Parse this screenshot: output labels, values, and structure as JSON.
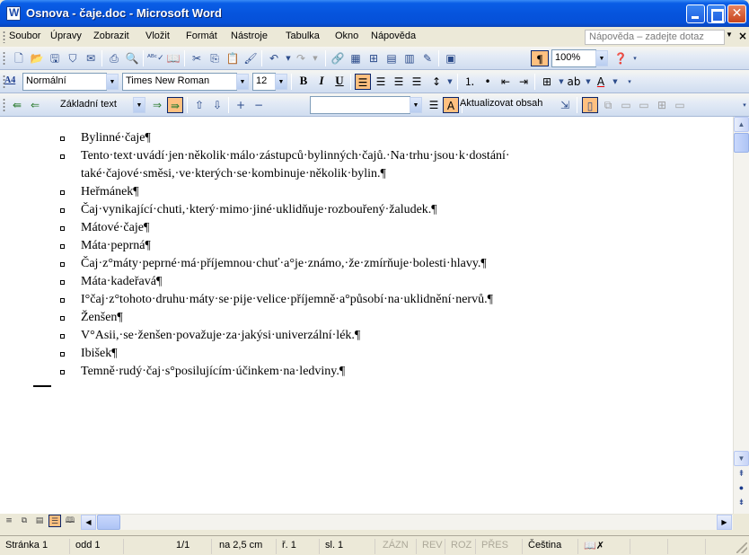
{
  "window": {
    "title": "Osnova - čaje.doc - Microsoft Word"
  },
  "menu": {
    "items": [
      "Soubor",
      "Úpravy",
      "Zobrazit",
      "Vložit",
      "Formát",
      "Nástroje",
      "Tabulka",
      "Okno",
      "Nápověda"
    ],
    "help_placeholder": "Nápověda – zadejte dotaz"
  },
  "toolbar_standard": {
    "zoom": "100%"
  },
  "toolbar_formatting": {
    "style": "Normální",
    "font": "Times New Roman",
    "size": "12"
  },
  "toolbar_outline": {
    "level": "Základní text",
    "update_label": "Aktualizovat obsah"
  },
  "document": {
    "lines": [
      "Bylinné·čaje¶",
      "Tento·text·uvádí·jen·několik·málo·zástupců·bylinných·čajů.·Na·trhu·jsou·k·dostání·",
      "také·čajové·směsi,·ve·kterých·se·kombinuje·několik·bylin.¶",
      "Heřmánek¶",
      "Čaj·vynikající·chuti,·který·mimo·jiné·uklidňuje·rozbouřený·žaludek.¶",
      "Mátové·čaje¶",
      "Máta·peprná¶",
      "Čaj·z°máty·peprné·má·příjemnou·chuť·a°je·známo,·že·zmírňuje·bolesti·hlavy.¶",
      "Máta·kadeřavá¶",
      "I°čaj·z°tohoto·druhu·máty·se·pije·velice·příjemně·a°působí·na·uklidnění·nervů.¶",
      "Ženšen¶",
      "V°Asii,·se·ženšen·považuje·za·jakýsi·univerzální·lék.¶",
      "Ibišek¶",
      "Temně·rudý·čaj·s°posilujícím·účinkem·na·ledviny.¶"
    ]
  },
  "statusbar": {
    "page": "Stránka 1",
    "section": "odd 1",
    "page_of": "1/1",
    "at": "na 2,5 cm",
    "line": "ř. 1",
    "col": "sl. 1",
    "rec": "ZÁZN",
    "rev": "REV",
    "ext": "ROZ",
    "ovr": "PŘES",
    "language": "Čeština"
  },
  "colors": {
    "title_bar": "#0654dd",
    "toolbar_active": "#ffc080",
    "close_button": "#c8441c"
  }
}
